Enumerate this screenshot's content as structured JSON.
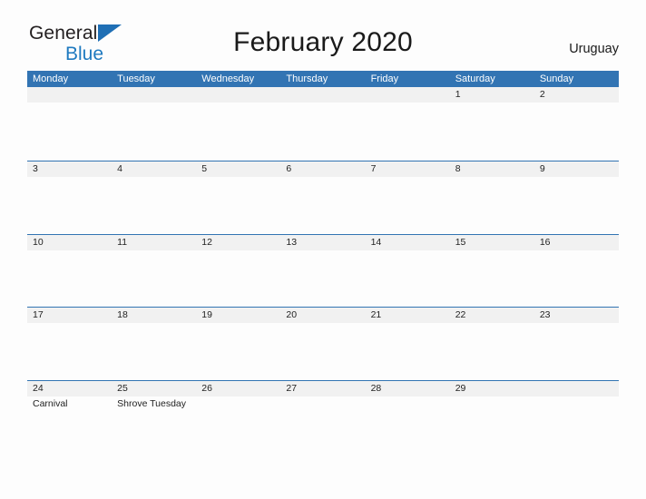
{
  "brand": {
    "name_part1": "General",
    "name_part2": "Blue",
    "triangle_icon": "triangle-icon",
    "accent_color": "#1f7ac0"
  },
  "header": {
    "title": "February 2020",
    "country": "Uruguay"
  },
  "theme": {
    "header_blue": "#3274b3",
    "band_gray": "#f1f1f1",
    "page_background": "#fdfdfd",
    "text_color": "#222222"
  },
  "calendar": {
    "month": "February",
    "year": "2020",
    "weekday_headers": [
      "Monday",
      "Tuesday",
      "Wednesday",
      "Thursday",
      "Friday",
      "Saturday",
      "Sunday"
    ],
    "weeks": [
      {
        "days": [
          {
            "num": "",
            "events": []
          },
          {
            "num": "",
            "events": []
          },
          {
            "num": "",
            "events": []
          },
          {
            "num": "",
            "events": []
          },
          {
            "num": "",
            "events": []
          },
          {
            "num": "1",
            "events": []
          },
          {
            "num": "2",
            "events": []
          }
        ]
      },
      {
        "days": [
          {
            "num": "3",
            "events": []
          },
          {
            "num": "4",
            "events": []
          },
          {
            "num": "5",
            "events": []
          },
          {
            "num": "6",
            "events": []
          },
          {
            "num": "7",
            "events": []
          },
          {
            "num": "8",
            "events": []
          },
          {
            "num": "9",
            "events": []
          }
        ]
      },
      {
        "days": [
          {
            "num": "10",
            "events": []
          },
          {
            "num": "11",
            "events": []
          },
          {
            "num": "12",
            "events": []
          },
          {
            "num": "13",
            "events": []
          },
          {
            "num": "14",
            "events": []
          },
          {
            "num": "15",
            "events": []
          },
          {
            "num": "16",
            "events": []
          }
        ]
      },
      {
        "days": [
          {
            "num": "17",
            "events": []
          },
          {
            "num": "18",
            "events": []
          },
          {
            "num": "19",
            "events": []
          },
          {
            "num": "20",
            "events": []
          },
          {
            "num": "21",
            "events": []
          },
          {
            "num": "22",
            "events": []
          },
          {
            "num": "23",
            "events": []
          }
        ]
      },
      {
        "days": [
          {
            "num": "24",
            "events": [
              "Carnival"
            ]
          },
          {
            "num": "25",
            "events": [
              "Shrove Tuesday"
            ]
          },
          {
            "num": "26",
            "events": []
          },
          {
            "num": "27",
            "events": []
          },
          {
            "num": "28",
            "events": []
          },
          {
            "num": "29",
            "events": []
          },
          {
            "num": "",
            "events": []
          }
        ]
      }
    ]
  }
}
